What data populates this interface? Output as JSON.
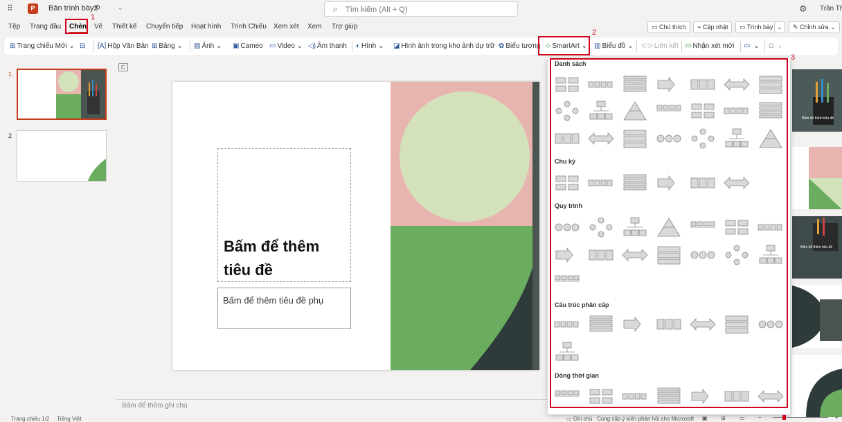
{
  "app": {
    "doc_title": "Bản trình bày2",
    "search_placeholder": "Tìm kiếm (Alt + Q)",
    "user": "Trần Thị"
  },
  "tabs": [
    "Tệp",
    "Trang đầu",
    "Chèn",
    "Vẽ",
    "Thiết kế",
    "Chuyển tiếp",
    "Hoạt hình",
    "Trình Chiếu",
    "Xem xét",
    "Xem",
    "Trợ giúp"
  ],
  "active_tab": "Chèn",
  "right_commands": {
    "comments": "Chú thích",
    "catch_up": "Cập nhật",
    "present": "Trình bày",
    "editing": "Chỉnh sửa"
  },
  "ribbon": {
    "new_slide": "Trang chiếu Mới",
    "textbox": "Hộp Văn Bản",
    "table": "Bảng",
    "pictures": "Ảnh",
    "cameo": "Cameo",
    "video": "Video",
    "audio": "Âm thanh",
    "shapes": "Hình",
    "stock_images": "Hình ảnh trong kho ảnh dự trữ",
    "icons": "Biểu tượng",
    "smartart": "SmartArt",
    "chart": "Biểu đồ",
    "link": "Liên kết",
    "new_comment": "Nhận xét mới"
  },
  "annotations": [
    "1",
    "2",
    "3"
  ],
  "slides": [
    {
      "number": "1"
    },
    {
      "number": "2"
    }
  ],
  "slide": {
    "title_placeholder": "Bấm để thêm tiêu đề",
    "subtitle_placeholder": "Bấm để thêm tiêu đề phụ"
  },
  "notes_placeholder": "Bấm để thêm ghi chú",
  "status": {
    "slide_count": "Trang chiếu 1/2",
    "language": "Tiếng Việt",
    "notes": "Ghi chú",
    "feedback": "Cung cấp ý kiến phản hồi cho Microsoft"
  },
  "smartart": {
    "sections": [
      "Danh sách",
      "Chu kỳ",
      "Quy trình",
      "Cấu trúc phân cấp",
      "Dòng thời gian"
    ]
  },
  "idea_thumb_text": "Bấm để thêm tiêu đề",
  "colors": {
    "brand": "#c43e1c",
    "highlight": "#d1001f",
    "pink": "#e8b4b0",
    "sage": "#d4e2bb",
    "green": "#6aad5f",
    "dark": "#2f3b3a"
  }
}
